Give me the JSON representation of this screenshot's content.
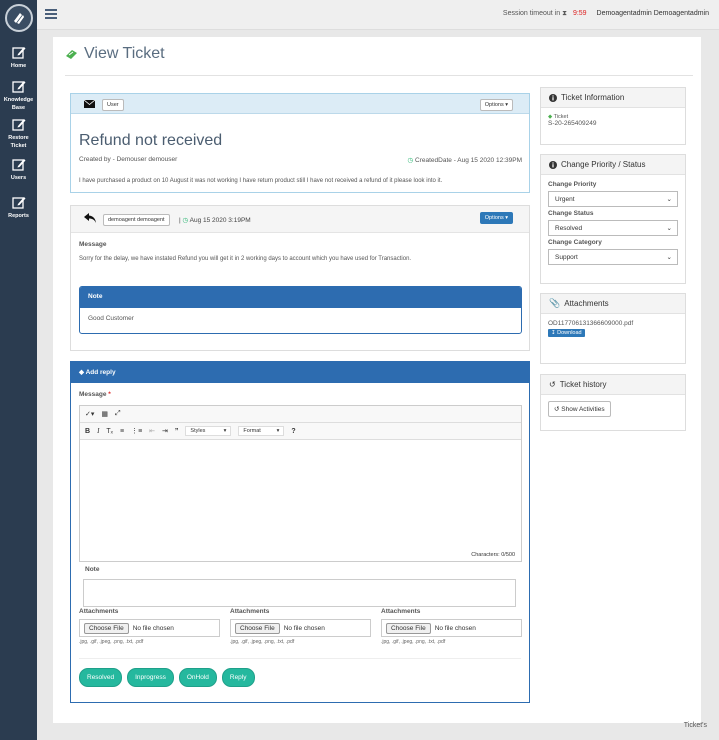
{
  "sidebar": {
    "items": [
      {
        "label": "Home",
        "icon": "edit-icon"
      },
      {
        "label": "Knowledge Base",
        "icon": "edit-icon"
      },
      {
        "label": "Restore Ticket",
        "icon": "edit-icon"
      },
      {
        "label": "Users",
        "icon": "edit-icon"
      },
      {
        "label": "Reports",
        "icon": "edit-icon"
      }
    ]
  },
  "topbar": {
    "session_label": "Session timeout in",
    "session_timer": "9:59",
    "user_name": "Demoagentadmin Demoagentadmin"
  },
  "page": {
    "title": "View Ticket"
  },
  "ticket": {
    "user_tag": "User",
    "options_label": "Options",
    "subject": "Refund not received",
    "created_by": "Created by - Demouser demouser",
    "created_date": "CreatedDate - Aug 15 2020 12:39PM",
    "description": "I have purchased a product on 10 August it was not working I have return product still I have not received a refund of it please look into it."
  },
  "reply": {
    "agent_tag": "demoagent demoagent",
    "date": "Aug 15 2020 3:19PM",
    "options_label": "Options",
    "message_label": "Message",
    "message": "Sorry for the delay, we have instated Refund you will get it in 2 working days to account which you have used for Transaction.",
    "note_label": "Note",
    "note_text": "Good Customer"
  },
  "add_reply": {
    "header": "Add reply",
    "message_label": "Message",
    "required_mark": "*",
    "styles_label": "Styles",
    "format_label": "Format",
    "characters": "Characters: 0/500",
    "note_label": "Note",
    "attachments": [
      {
        "label": "Attachments",
        "button": "Choose File",
        "status": "No file chosen",
        "types": ".jpg, .gif, .jpeg, .png, .txt, .pdf"
      },
      {
        "label": "Attachments",
        "button": "Choose File",
        "status": "No file chosen",
        "types": ".jpg, .gif, .jpeg, .png, .txt, .pdf"
      },
      {
        "label": "Attachments",
        "button": "Choose File",
        "status": "No file chosen",
        "types": ".jpg, .gif, .jpeg, .png, .txt, .pdf"
      }
    ],
    "buttons": {
      "resolved": "Resolved",
      "inprogress": "Inprogress",
      "onhold": "OnHold",
      "reply": "Reply"
    }
  },
  "ticket_info": {
    "title": "Ticket Information",
    "ticket_label": "Ticket",
    "ticket_id": "S-20-265409249"
  },
  "priority_status": {
    "title": "Change Priority / Status",
    "priority_label": "Change Priority",
    "priority_value": "Urgent",
    "status_label": "Change Status",
    "status_value": "Resolved",
    "category_label": "Change Category",
    "category_value": "Support"
  },
  "attachments_box": {
    "title": "Attachments",
    "file_name": "OD117706131366609000.pdf",
    "download_label": "Download"
  },
  "history": {
    "title": "Ticket history",
    "button": "Show Activities"
  },
  "footer": {
    "text": "Ticket's"
  },
  "colors": {
    "sidebar": "#2b3c50",
    "primary_blue": "#2d6cb0",
    "green_button": "#25b89e",
    "timer_red": "#dd2222"
  }
}
